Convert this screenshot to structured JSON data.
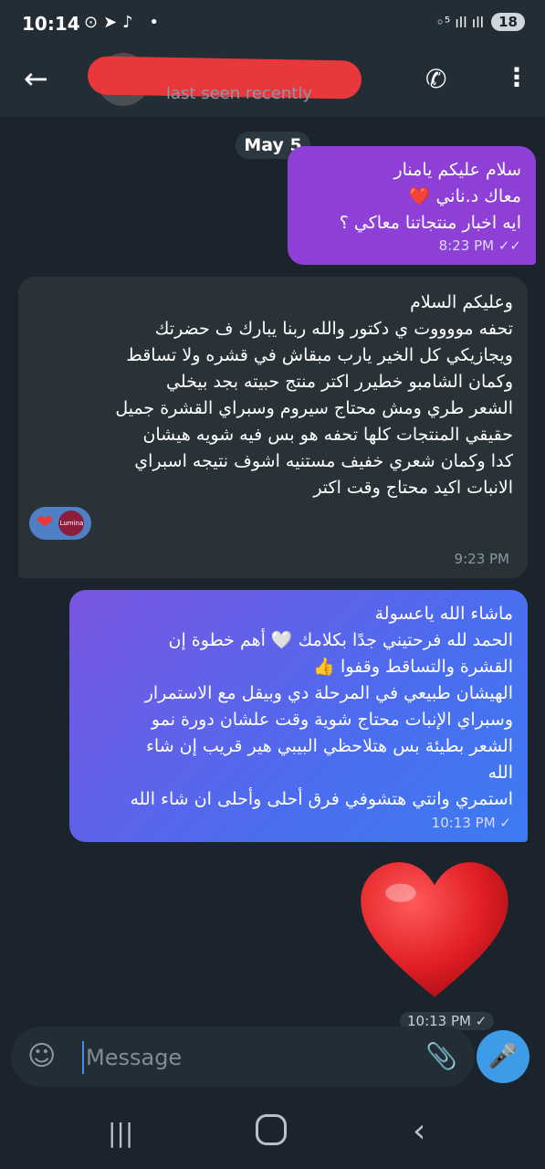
{
  "status_bar": {
    "time": "10:14",
    "notification_icons": "⊙➤♪ •",
    "signal": "◦⁵ ıll ıll",
    "battery": "18"
  },
  "header": {
    "back_icon": "←",
    "status": "last seen recently",
    "call_icon": "✆",
    "menu_icon": "⋮"
  },
  "date_chip": "May 5",
  "messages": [
    {
      "lines": [
        "سلام عليكم يامنار",
        "معاك د.ناني ❤️",
        "ايه اخبار منتجاتنا معاكي ؟"
      ],
      "time": "8:23 PM",
      "ticks": "✓✓"
    },
    {
      "lines": [
        "وعليكم السلام",
        "تحفه مووووت ي دكتور والله ربنا يبارك ف حضرتك",
        "ويجازيكي كل الخير يارب مبقاش في قشره ولا تساقط",
        "وكمان الشامبو خطيرر اكتر منتج حبيته بجد بيخلي",
        "الشعر طري ومش محتاج سيروم وسبراي القشرة جميل",
        "حقيقي  المنتجات كلها تحفه هو بس فيه شويه هيشان",
        "كدا وكمان شعري خفيف مستنيه اشوف نتيجه اسبراي",
        "الانبات اكيد محتاج وقت اكتر"
      ],
      "reactions": [
        "❤",
        "Lumina"
      ],
      "time": "9:23 PM"
    },
    {
      "lines": [
        "ماشاء الله ياعسولة",
        "الحمد لله فرحتيني جدًا بكلامك 🤍 أهم خطوة إن",
        "القشرة والتساقط وقفوا 👍",
        "الهيشان طبيعي في المرحلة دي وبيقل مع الاستمرار",
        " وسبراي الإنبات محتاج شوية وقت علشان دورة نمو",
        "الشعر بطيئة بس هتلاحظي البيبي هير قريب إن شاء",
        "الله",
        "استمري وانتي هتشوفي فرق أحلى وأحلى  ان شاء الله"
      ],
      "time": "10:13 PM",
      "ticks": "✓"
    },
    {
      "emoji": "❤️",
      "time": "10:13 PM",
      "ticks": "✓"
    }
  ],
  "input": {
    "placeholder": "Message",
    "emoji_icon": "☺",
    "attach_icon": "📎",
    "mic_icon": "🎤"
  },
  "nav": {
    "recent": "|||",
    "back": "‹"
  },
  "colors": {
    "background": "#1b242c",
    "header": "#232d36",
    "outgoing_purple": "#8e3fd6",
    "outgoing_blue": "#4c6cf0",
    "incoming": "#283237",
    "accent": "#3e9be8",
    "heart": "#e8383b"
  }
}
